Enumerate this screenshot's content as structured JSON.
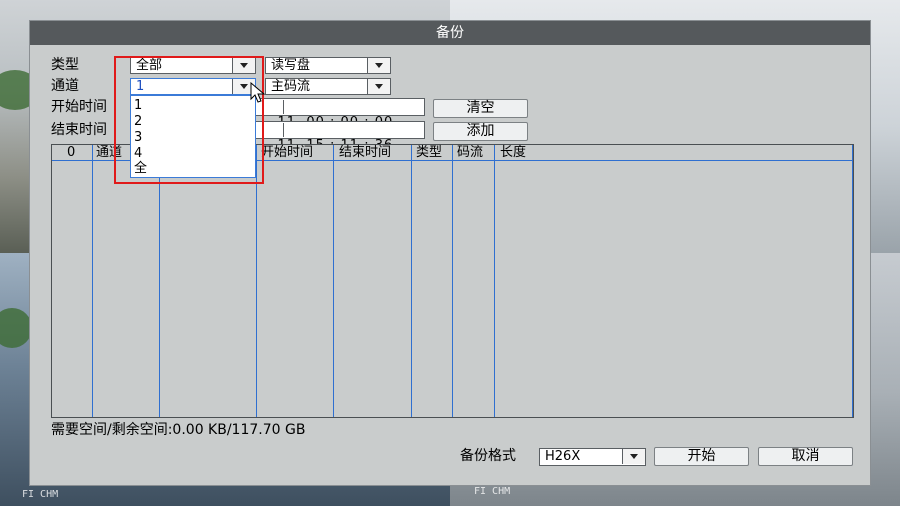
{
  "background": {
    "camera_stamps": [
      "FI CHM",
      "FI CHM"
    ]
  },
  "dialog": {
    "title": "备份",
    "type_label": "类型",
    "type_value": "全部",
    "device_value": "读写盘",
    "channel_label": "通道",
    "channel_value": "1",
    "stream_value": "主码流",
    "start_time_label": "开始时间",
    "start_time_value": "11  00 : 00 : 00",
    "end_time_label": "结束时间",
    "end_time_value": "11  15 : 11 : 36",
    "clear_button": "清空",
    "add_button": "添加",
    "channel_options": [
      "1",
      "2",
      "3",
      "4",
      "全"
    ],
    "table": {
      "headers": [
        "0",
        "通道",
        "",
        "开始时间",
        "结束时间",
        "类型",
        "码流",
        "长度"
      ]
    },
    "space_status": "需要空间/剩余空间:0.00 KB/117.70 GB",
    "format_label": "备份格式",
    "format_value": "H26X",
    "start_button": "开始",
    "cancel_button": "取消"
  },
  "colors": {
    "titlebar": "#55595c",
    "dialog_bg": "#c9cccc",
    "highlight_border": "#e01a1a",
    "grid_line": "#2f6fd0"
  }
}
